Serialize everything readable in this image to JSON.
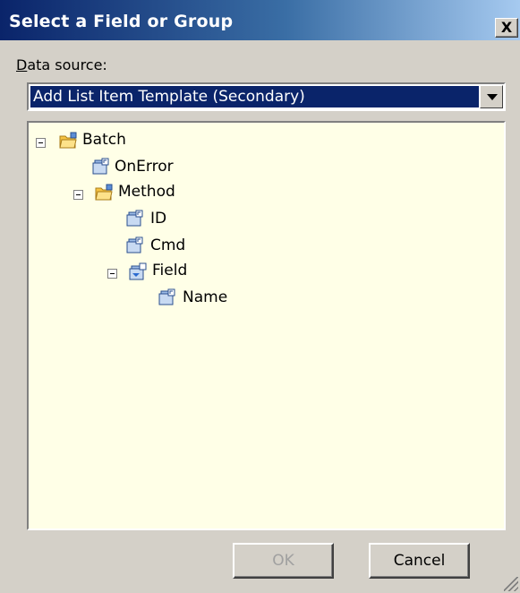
{
  "window": {
    "title": "Select a Field or Group",
    "close_glyph": "X"
  },
  "data_source": {
    "label_mnemonic": "D",
    "label_rest": "ata source:",
    "selected": "Add List Item Template (Secondary)"
  },
  "tree": {
    "nodes": [
      {
        "label": "Batch",
        "icon": "folder-icon",
        "expanded": true
      },
      {
        "label": "OnError",
        "icon": "field-icon"
      },
      {
        "label": "Method",
        "icon": "folder-icon",
        "expanded": true
      },
      {
        "label": "ID",
        "icon": "field-icon"
      },
      {
        "label": "Cmd",
        "icon": "field-icon"
      },
      {
        "label": "Field",
        "icon": "repeating-group-icon",
        "expanded": true
      },
      {
        "label": "Name",
        "icon": "field-icon"
      }
    ]
  },
  "buttons": {
    "ok_label": "OK",
    "cancel_label": "Cancel"
  },
  "colors": {
    "title_start": "#0a246a",
    "title_end": "#a6caf0",
    "tree_bg": "#ffffe7",
    "selection": "#0a246a"
  }
}
